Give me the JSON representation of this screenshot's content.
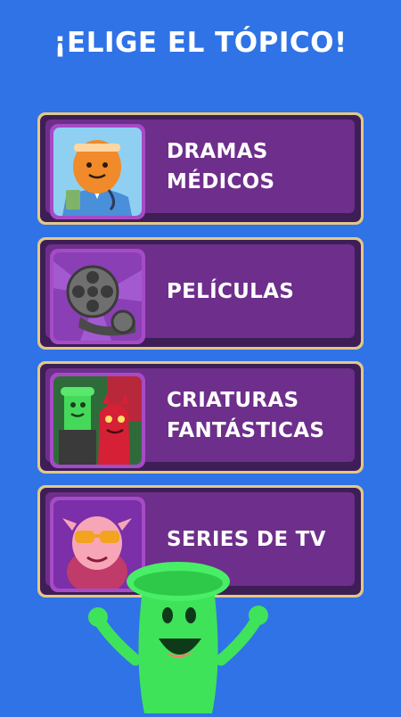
{
  "header": {
    "title": "¡ELIGE EL TÓPICO!"
  },
  "topics": [
    {
      "line1": "DRAMAS",
      "line2": "MÉDICOS",
      "icon": "doctor-egg-icon"
    },
    {
      "line1": "PELÍCULAS",
      "line2": "",
      "icon": "film-reel-icon"
    },
    {
      "line1": "CRIATURAS",
      "line2": "FANTÁSTICAS",
      "icon": "monsters-icon"
    },
    {
      "line1": "SERIES DE TV",
      "line2": "",
      "icon": "tv-character-icon"
    }
  ],
  "colors": {
    "background": "#2f73e6",
    "card_border": "#e4c887",
    "card_face": "#6e2e8b",
    "mascot": "#3ee35a"
  }
}
